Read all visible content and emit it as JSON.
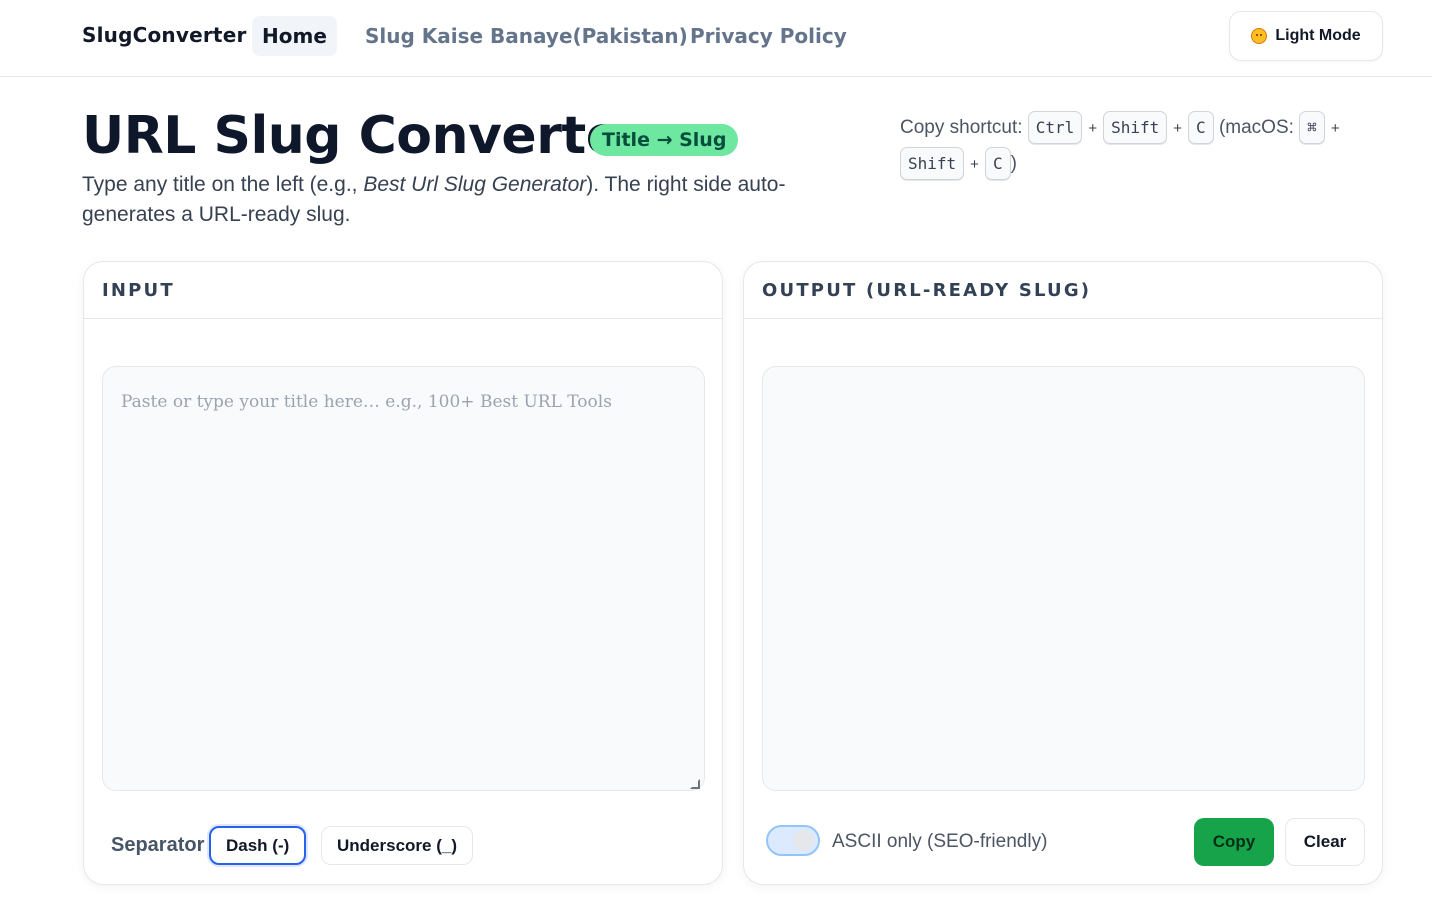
{
  "nav": {
    "brand": "SlugConverter",
    "links": [
      {
        "label": "Home",
        "active": true
      },
      {
        "label": "Slug Kaise Banaye(Pakistan)",
        "active": false
      },
      {
        "label": "Privacy Policy",
        "active": false
      }
    ],
    "theme_button": {
      "label": "Light Mode",
      "icon": "smiling-face-icon"
    }
  },
  "hero": {
    "title": "URL Slug Converter",
    "badge": "Title → Slug",
    "desc_prefix": "Type any title on the left (e.g., ",
    "desc_example": "Best Url Slug Generator",
    "desc_suffix": "). The right side auto-generates a URL-ready slug."
  },
  "shortcut": {
    "label": "Copy shortcut:",
    "keys_win": [
      "Ctrl",
      "Shift",
      "C"
    ],
    "macos_label": "(macOS:",
    "keys_mac": [
      "⌘",
      "Shift",
      "C"
    ],
    "close": ")",
    "plus": "+"
  },
  "input_panel": {
    "heading": "INPUT",
    "value": "",
    "placeholder": "Paste or type your title here… e.g., 100+ Best URL Tools",
    "separator_label": "Separator",
    "separators": [
      {
        "label": "Dash (-)",
        "selected": true
      },
      {
        "label": "Underscore (_)",
        "selected": false
      }
    ]
  },
  "output_panel": {
    "heading": "OUTPUT (URL-READY SLUG)",
    "value": "",
    "ascii_toggle": {
      "label": "ASCII only (SEO-friendly)",
      "on": false
    },
    "copy_label": "Copy",
    "clear_label": "Clear"
  },
  "colors": {
    "accent_green": "#16a34a",
    "badge_green": "#6ee7a1",
    "selected_border": "#2563eb"
  }
}
